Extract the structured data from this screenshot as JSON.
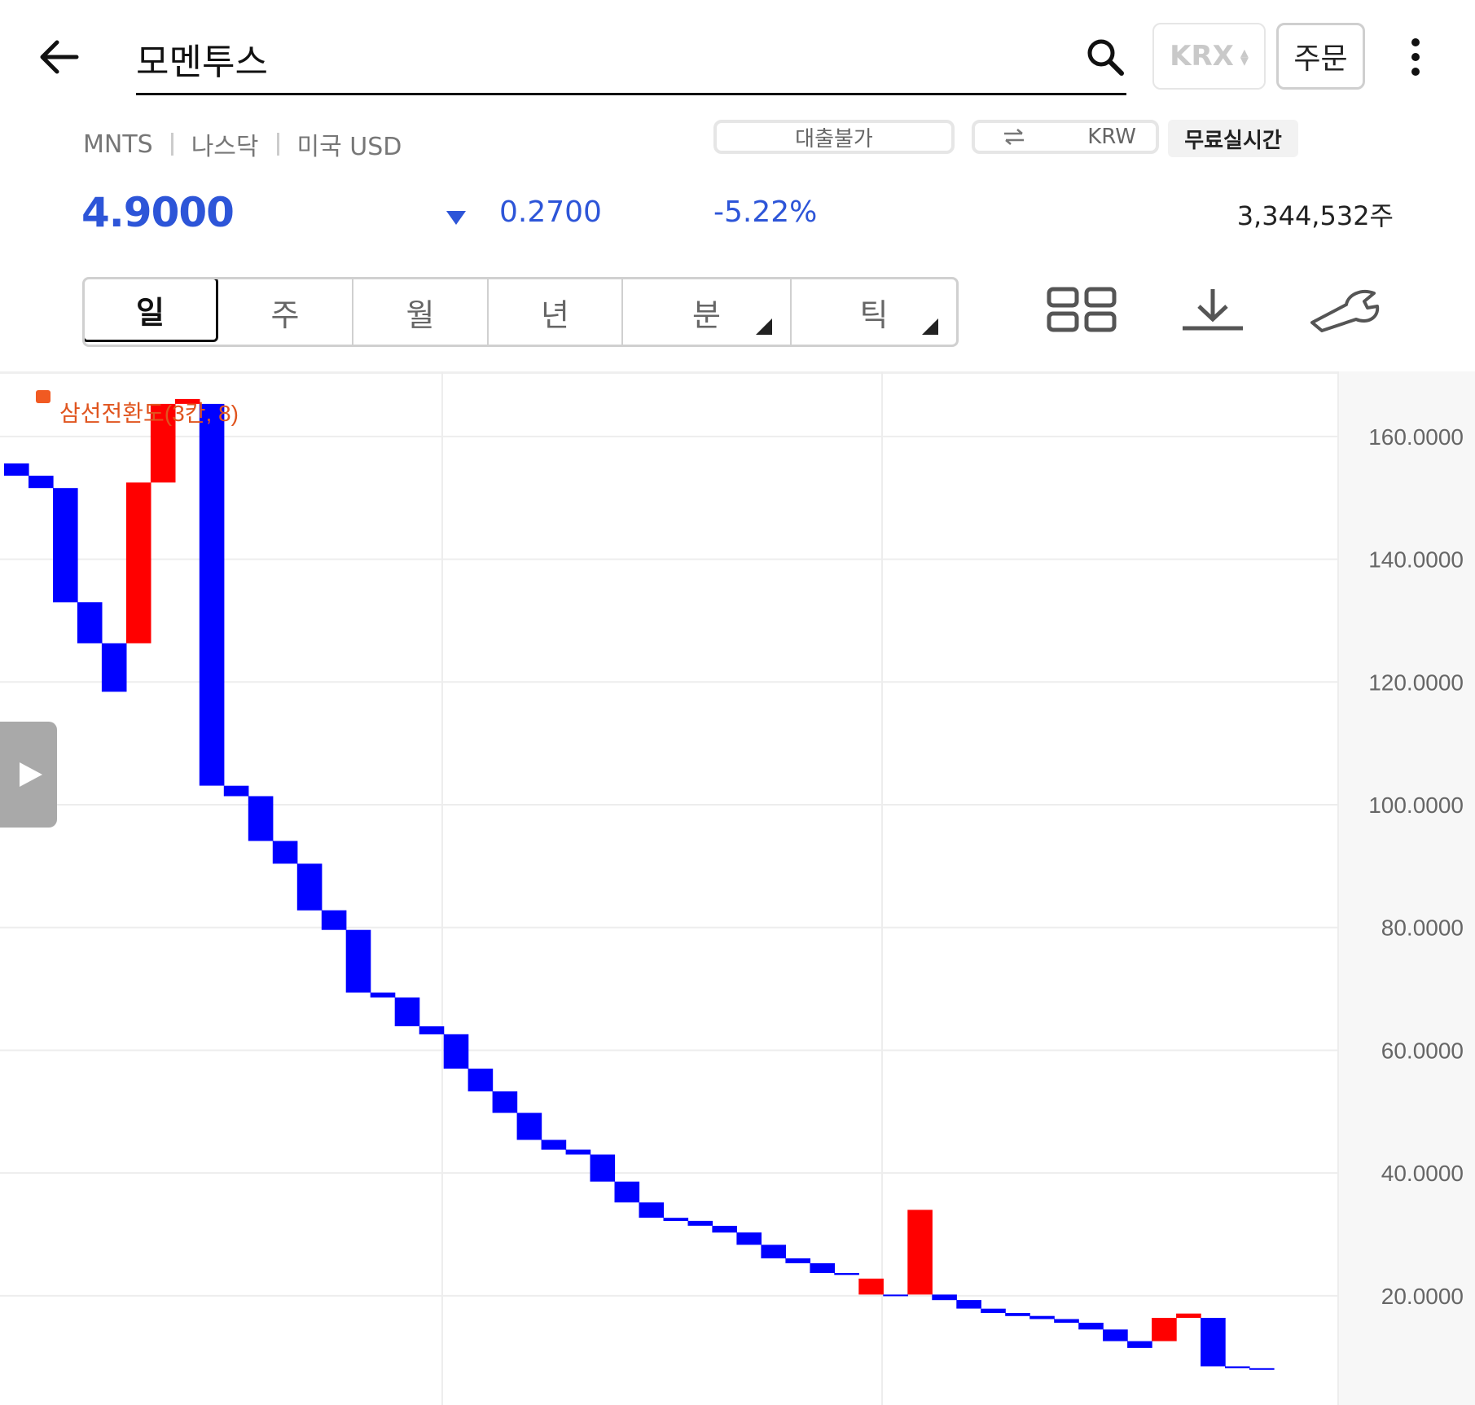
{
  "header": {
    "search_value": "모멘투스",
    "exchange_label": "KRX",
    "order_label": "주문"
  },
  "meta": {
    "ticker": "MNTS",
    "market": "나스닥",
    "currency": "미국 USD",
    "loan_label": "대출불가",
    "fx_label": "KRW",
    "realtime_label": "무료실시간"
  },
  "quote": {
    "price": "4.9000",
    "change": "0.2700",
    "change_pct": "-5.22%",
    "volume": "3,344,532주",
    "direction": "down"
  },
  "period_tabs": [
    "일",
    "주",
    "월",
    "년",
    "분",
    "틱"
  ],
  "toolbar_icons": [
    "layout-grid-icon",
    "download-icon",
    "wrench-icon"
  ],
  "colors": {
    "up": "#ff0000",
    "down": "#0000ff",
    "accent": "#2d55d8",
    "indicator": "#f15a22"
  },
  "chart_data": {
    "type": "three-line-break",
    "indicator_label": "삼선전환도(3칸, 8)",
    "y_ticks": [
      "160.0000",
      "140.0000",
      "120.0000",
      "100.0000",
      "80.0000",
      "60.0000",
      "40.0000",
      "20.0000"
    ],
    "ylim": [
      2.2,
      170.6
    ],
    "bricks": [
      {
        "dir": "down",
        "open": 155.6,
        "close": 153.6
      },
      {
        "dir": "down",
        "open": 153.6,
        "close": 151.6
      },
      {
        "dir": "down",
        "open": 151.6,
        "close": 133.0
      },
      {
        "dir": "down",
        "open": 133.0,
        "close": 126.3
      },
      {
        "dir": "down",
        "open": 126.3,
        "close": 118.4
      },
      {
        "dir": "up",
        "open": 126.3,
        "close": 152.5
      },
      {
        "dir": "up",
        "open": 152.5,
        "close": 165.3
      },
      {
        "dir": "up",
        "open": 165.3,
        "close": 166.1
      },
      {
        "dir": "down",
        "open": 165.3,
        "close": 103.1
      },
      {
        "dir": "down",
        "open": 103.1,
        "close": 101.4
      },
      {
        "dir": "down",
        "open": 101.4,
        "close": 94.1
      },
      {
        "dir": "down",
        "open": 94.1,
        "close": 90.4
      },
      {
        "dir": "down",
        "open": 90.4,
        "close": 82.8
      },
      {
        "dir": "down",
        "open": 82.8,
        "close": 79.6
      },
      {
        "dir": "down",
        "open": 79.6,
        "close": 69.4
      },
      {
        "dir": "down",
        "open": 69.4,
        "close": 68.6
      },
      {
        "dir": "down",
        "open": 68.6,
        "close": 63.9
      },
      {
        "dir": "down",
        "open": 63.9,
        "close": 62.6
      },
      {
        "dir": "down",
        "open": 62.6,
        "close": 57.0
      },
      {
        "dir": "down",
        "open": 57.0,
        "close": 53.3
      },
      {
        "dir": "down",
        "open": 53.3,
        "close": 49.8
      },
      {
        "dir": "down",
        "open": 49.8,
        "close": 45.4
      },
      {
        "dir": "down",
        "open": 45.4,
        "close": 43.8
      },
      {
        "dir": "down",
        "open": 43.8,
        "close": 43.0
      },
      {
        "dir": "down",
        "open": 43.0,
        "close": 38.6
      },
      {
        "dir": "down",
        "open": 38.6,
        "close": 35.2
      },
      {
        "dir": "down",
        "open": 35.2,
        "close": 32.7
      },
      {
        "dir": "down",
        "open": 32.7,
        "close": 32.2
      },
      {
        "dir": "down",
        "open": 32.2,
        "close": 31.4
      },
      {
        "dir": "down",
        "open": 31.4,
        "close": 30.3
      },
      {
        "dir": "down",
        "open": 30.3,
        "close": 28.3
      },
      {
        "dir": "down",
        "open": 28.3,
        "close": 26.1
      },
      {
        "dir": "down",
        "open": 26.1,
        "close": 25.3
      },
      {
        "dir": "down",
        "open": 25.3,
        "close": 23.7
      },
      {
        "dir": "down",
        "open": 23.7,
        "close": 23.4
      },
      {
        "dir": "up",
        "open": 20.2,
        "close": 22.8
      },
      {
        "dir": "down",
        "open": 20.2,
        "close": 20.0
      },
      {
        "dir": "up",
        "open": 20.2,
        "close": 34.0
      },
      {
        "dir": "down",
        "open": 20.2,
        "close": 19.3
      },
      {
        "dir": "down",
        "open": 19.3,
        "close": 17.9
      },
      {
        "dir": "down",
        "open": 17.9,
        "close": 17.2
      },
      {
        "dir": "down",
        "open": 17.2,
        "close": 16.7
      },
      {
        "dir": "down",
        "open": 16.7,
        "close": 16.2
      },
      {
        "dir": "down",
        "open": 16.2,
        "close": 15.6
      },
      {
        "dir": "down",
        "open": 15.6,
        "close": 14.5
      },
      {
        "dir": "down",
        "open": 14.5,
        "close": 12.6
      },
      {
        "dir": "down",
        "open": 12.6,
        "close": 11.5
      },
      {
        "dir": "up",
        "open": 12.6,
        "close": 16.4
      },
      {
        "dir": "up",
        "open": 16.4,
        "close": 17.1
      },
      {
        "dir": "down",
        "open": 16.4,
        "close": 8.5
      },
      {
        "dir": "down",
        "open": 8.5,
        "close": 8.2
      },
      {
        "dir": "down",
        "open": 8.2,
        "close": 8.1
      }
    ]
  }
}
